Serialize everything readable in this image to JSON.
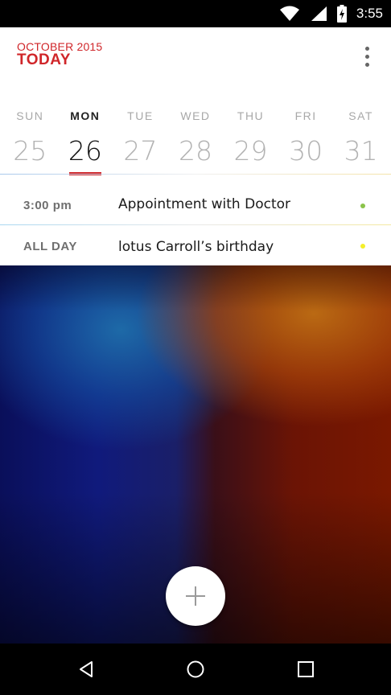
{
  "status_bar": {
    "time": "3:55",
    "icons": [
      "wifi-icon",
      "cell-signal-icon",
      "battery-charging-icon"
    ]
  },
  "header": {
    "month": "OCTOBER 2015",
    "title": "TODAY",
    "menu_icon": "more-vert-icon"
  },
  "week": {
    "days": [
      {
        "dow": "SUN",
        "num": "25"
      },
      {
        "dow": "MON",
        "num": "26"
      },
      {
        "dow": "TUE",
        "num": "27"
      },
      {
        "dow": "WED",
        "num": "28"
      },
      {
        "dow": "THU",
        "num": "29"
      },
      {
        "dow": "FRI",
        "num": "30"
      },
      {
        "dow": "SAT",
        "num": "31"
      }
    ],
    "selected": "MON"
  },
  "events": [
    {
      "time": "3:00 pm",
      "title": "Appointment with Doctor",
      "dot_color": "#8bc34a"
    },
    {
      "time": "ALL DAY",
      "title": "lotus Carroll’s birthday",
      "dot_color": "#f4ef2a"
    }
  ],
  "colors": {
    "accent": "#d0262a"
  },
  "fab": {
    "icon": "plus-icon"
  },
  "nav_bar": {
    "icons": [
      "back-icon",
      "home-icon",
      "recents-icon"
    ]
  }
}
